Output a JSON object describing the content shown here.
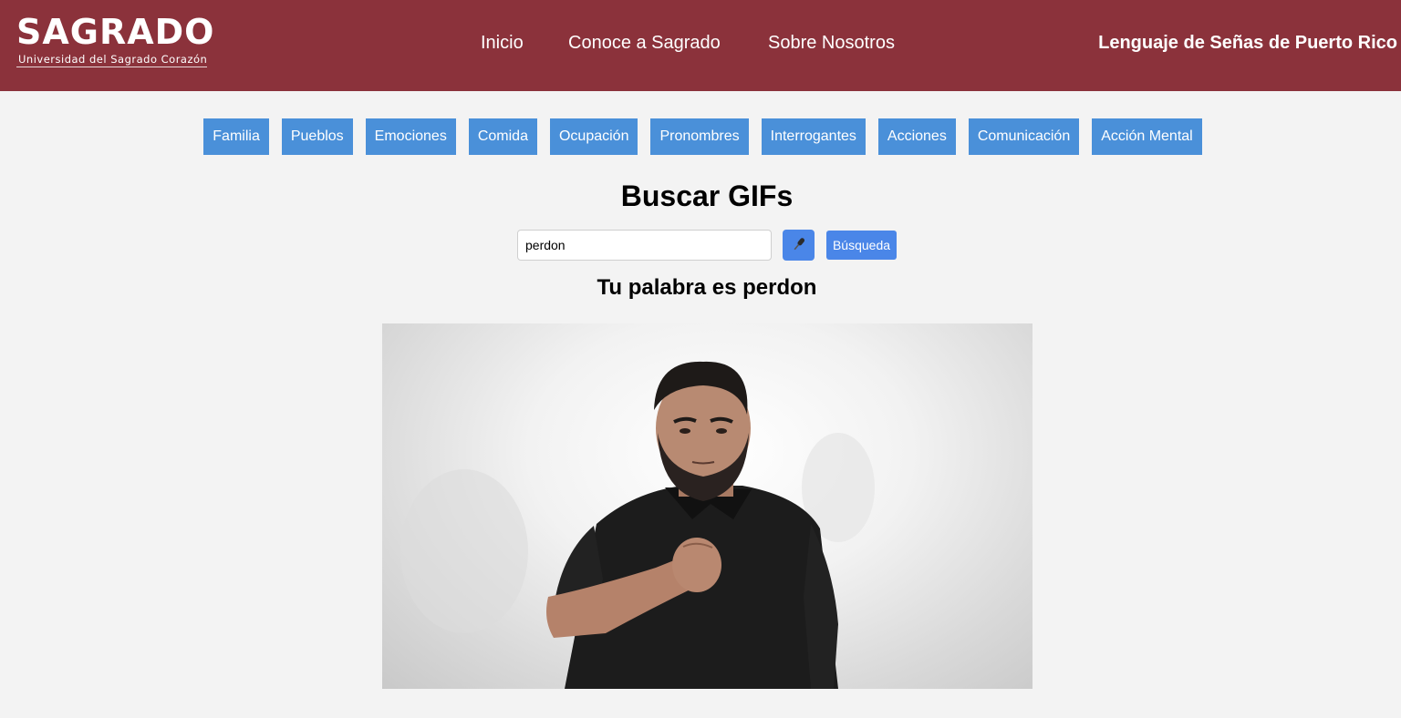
{
  "header": {
    "logo": {
      "main": "SAGRADO",
      "sub": "Universidad del Sagrado Corazón"
    },
    "nav": [
      "Inicio",
      "Conoce a Sagrado",
      "Sobre Nosotros"
    ],
    "site_title": "Lenguaje de Señas de Puerto Rico",
    "background_color": "#8b323b"
  },
  "categories": [
    "Familia",
    "Pueblos",
    "Emociones",
    "Comida",
    "Ocupación",
    "Pronombres",
    "Interrogantes",
    "Acciones",
    "Comunicación",
    "Acción Mental"
  ],
  "search": {
    "title": "Buscar GIFs",
    "value": "perdon",
    "mic_icon": "microphone-icon",
    "button_label": "Búsqueda"
  },
  "result": {
    "title": "Tu palabra es perdon",
    "gif_subject": "sign-language-person"
  },
  "colors": {
    "accent": "#4a86e8",
    "category": "#4a90d9",
    "page_bg": "#f3f3f3"
  }
}
